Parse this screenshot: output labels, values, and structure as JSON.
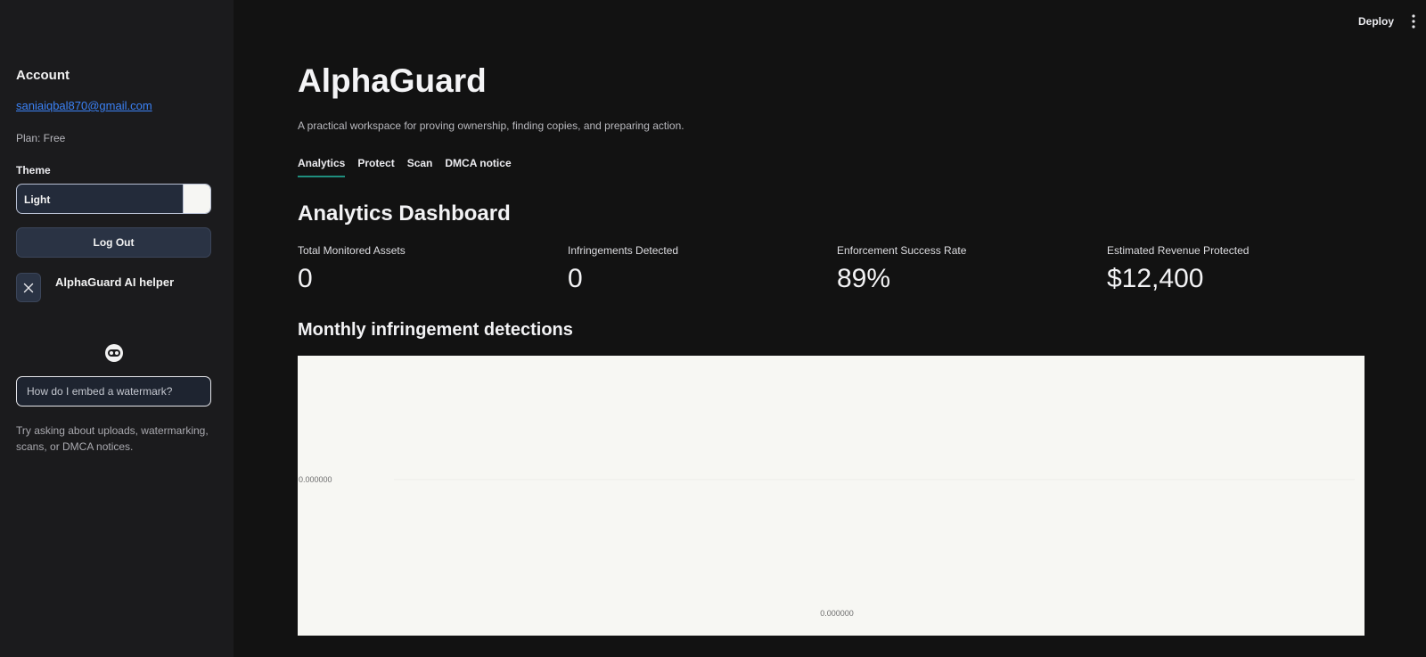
{
  "sidebar": {
    "heading": "Account",
    "email": "saniaiqbal870@gmail.com",
    "plan": "Plan: Free",
    "theme_label": "Theme",
    "theme_value": "Light",
    "logout_label": "Log Out",
    "helper_title": "AlphaGuard AI helper",
    "ask_placeholder": "How do I embed a watermark?",
    "hint": "Try asking about uploads, watermarking, scans, or DMCA notices."
  },
  "header": {
    "deploy_label": "Deploy"
  },
  "main": {
    "title": "AlphaGuard",
    "subtitle": "A practical workspace for proving ownership, finding copies, and preparing action.",
    "tabs": [
      {
        "label": "Analytics"
      },
      {
        "label": "Protect"
      },
      {
        "label": "Scan"
      },
      {
        "label": "DMCA notice"
      }
    ],
    "section_title": "Analytics Dashboard",
    "metrics": [
      {
        "label": "Total Monitored Assets",
        "value": "0"
      },
      {
        "label": "Infringements Detected",
        "value": "0"
      },
      {
        "label": "Enforcement Success Rate",
        "value": "89%"
      },
      {
        "label": "Estimated Revenue Protected",
        "value": "$12,400"
      }
    ],
    "chart_title": "Monthly infringement detections"
  },
  "chart_data": {
    "type": "line",
    "title": "Monthly infringement detections",
    "x": [
      0
    ],
    "series": [
      {
        "values": [
          0
        ]
      }
    ],
    "x_tick_labels": [
      "0.000000"
    ],
    "y_tick_labels": [
      "0.000000"
    ],
    "grid": true
  },
  "colors": {
    "accent": "#1f8f7e",
    "link": "#3b82f6",
    "background": "#121212",
    "sidebar_background": "#1b1b1d",
    "chart_background": "#f7f7f3"
  }
}
